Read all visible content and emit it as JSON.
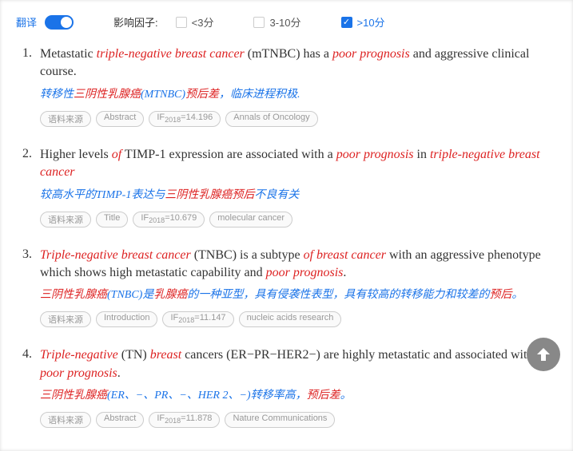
{
  "filter": {
    "translate_label": "翻译",
    "factor_label": "影响因子:",
    "options": [
      {
        "label": "<3分",
        "checked": false
      },
      {
        "label": "3-10分",
        "checked": false
      },
      {
        "label": ">10分",
        "checked": true
      }
    ]
  },
  "results": [
    {
      "num": "1.",
      "english": "Metastatic <em>triple-negative breast cancer</em> (mTNBC) has a <em>poor prognosis</em> and aggressive clinical course.",
      "chinese": "转移性<em>三阴性乳腺癌</em>(MTNBC)<em>预后差</em>，临床进程积极.",
      "tags": [
        "语料来源",
        "Abstract",
        "IF<sub>2018</sub>=14.196",
        "Annals of Oncology"
      ]
    },
    {
      "num": "2.",
      "english": "Higher levels <em>of</em> TIMP-1 expression are associated with a <em>poor prognosis</em> in <em>triple-negative breast cancer</em>",
      "chinese": "较高水平的TIMP-1表达与<em>三阴性乳腺癌预后</em>不良有关",
      "tags": [
        "语料来源",
        "Title",
        "IF<sub>2018</sub>=10.679",
        "molecular cancer"
      ]
    },
    {
      "num": "3.",
      "english": "<em>Triple-negative breast cancer</em> (TNBC) is a subtype <em>of breast cancer</em> with an aggressive phenotype which shows high metastatic capability and <em>poor prognosis</em>.",
      "chinese": "<em>三阴性乳腺癌</em>(TNBC)是<em>乳腺癌</em>的一种亚型，具有侵袭性表型，具有较高的转移能力和较差的<em>预后</em>。",
      "tags": [
        "语料来源",
        "Introduction",
        "IF<sub>2018</sub>=11.147",
        "nucleic acids research"
      ]
    },
    {
      "num": "4.",
      "english": "<em>Triple-negative</em> (TN) <em>breast</em> cancers (ER−PR−HER2−) are highly metastatic and associated with <em>poor prognosis</em>.",
      "chinese": "<em>三阴性乳腺癌</em>(ER、−、PR、−、HER 2、−)转移率高，<em>预后差</em>。",
      "tags": [
        "语料来源",
        "Abstract",
        "IF<sub>2018</sub>=11.878",
        "Nature Communications"
      ]
    }
  ]
}
